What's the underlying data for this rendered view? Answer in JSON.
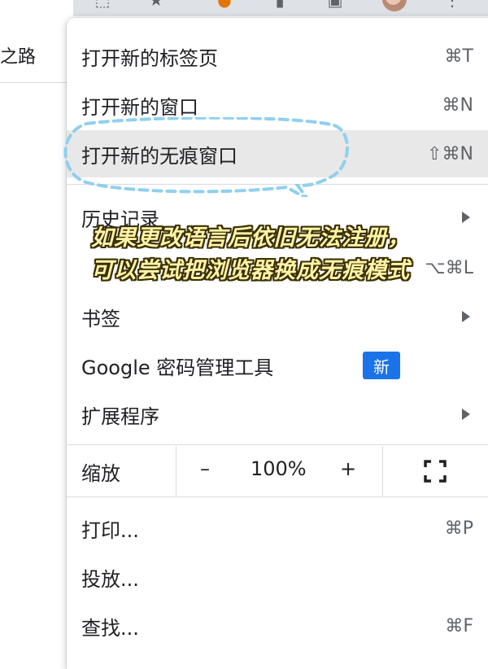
{
  "background": {
    "page_fragment": "之路"
  },
  "menu": {
    "items": [
      {
        "label": "打开新的标签页",
        "shortcut": "⌘T"
      },
      {
        "label": "打开新的窗口",
        "shortcut": "⌘N"
      },
      {
        "label": "打开新的无痕窗口",
        "shortcut": "⇧⌘N"
      },
      {
        "label": "历史记录",
        "shortcut": ""
      },
      {
        "label": "",
        "shortcut": "⌥⌘L"
      },
      {
        "label": "书签",
        "shortcut": ""
      },
      {
        "label": "Google 密码管理工具",
        "badge": "新"
      },
      {
        "label": "扩展程序",
        "shortcut": ""
      },
      {
        "label": "打印...",
        "shortcut": "⌘P"
      },
      {
        "label": "投放...",
        "shortcut": ""
      },
      {
        "label": "查找...",
        "shortcut": "⌘F"
      }
    ],
    "zoom": {
      "label": "缩放",
      "minus": "–",
      "value": "100%",
      "plus": "+"
    }
  },
  "annotation": {
    "caption_line1": "如果更改语言后依旧无法注册，",
    "caption_line2": "可以尝试把浏览器换成无痕模式",
    "highlight_color": "#8fd0ee",
    "caption_color": "#fff4a8"
  }
}
